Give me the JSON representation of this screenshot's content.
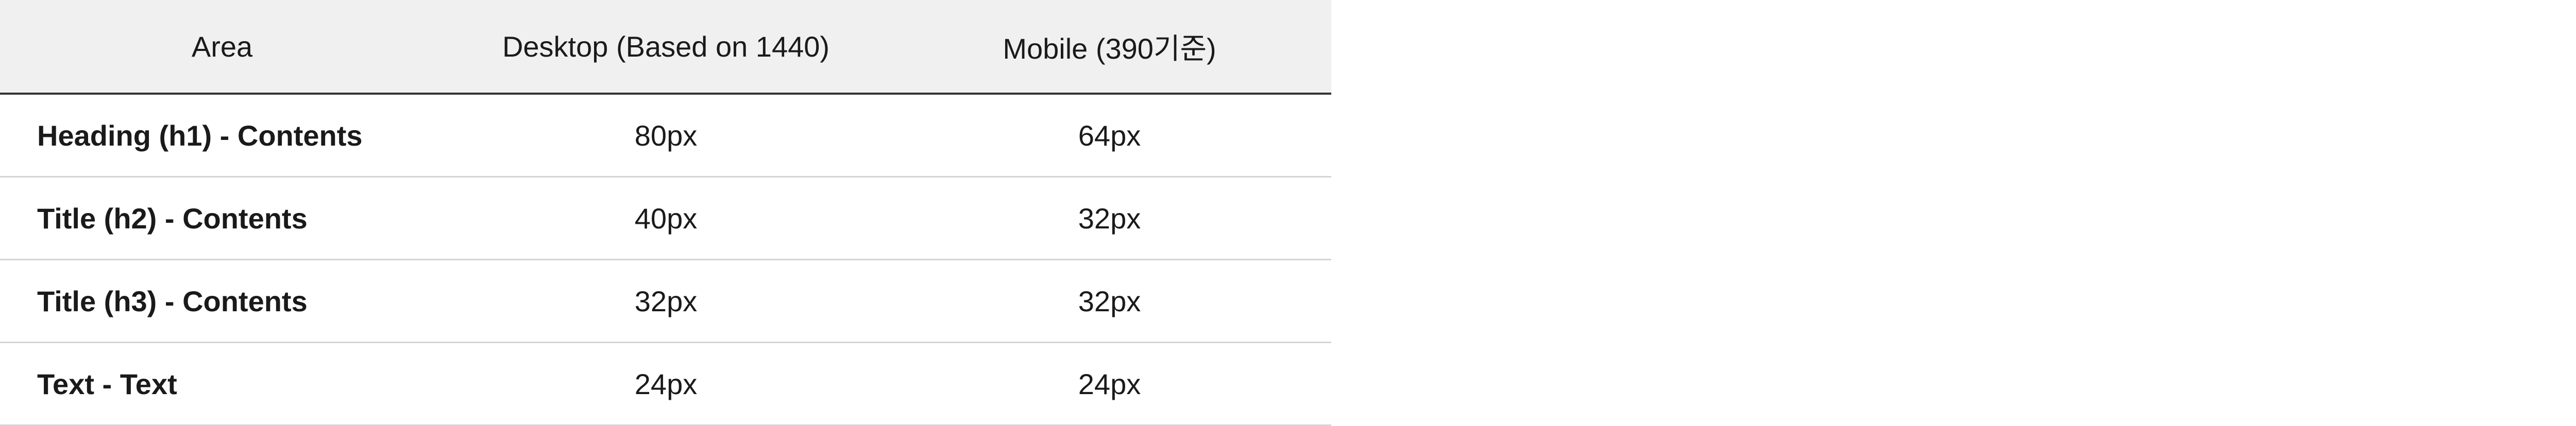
{
  "table": {
    "headers": {
      "area": "Area",
      "desktop": "Desktop (Based on 1440)",
      "mobile": "Mobile (390기준)"
    },
    "rows": [
      {
        "area": "Heading (h1) - Contents",
        "desktop": "80px",
        "mobile": "64px"
      },
      {
        "area": "Title (h2) - Contents",
        "desktop": "40px",
        "mobile": "32px"
      },
      {
        "area": "Title (h3) - Contents",
        "desktop": "32px",
        "mobile": "32px"
      },
      {
        "area": "Text - Text",
        "desktop": "24px",
        "mobile": "24px"
      }
    ]
  }
}
